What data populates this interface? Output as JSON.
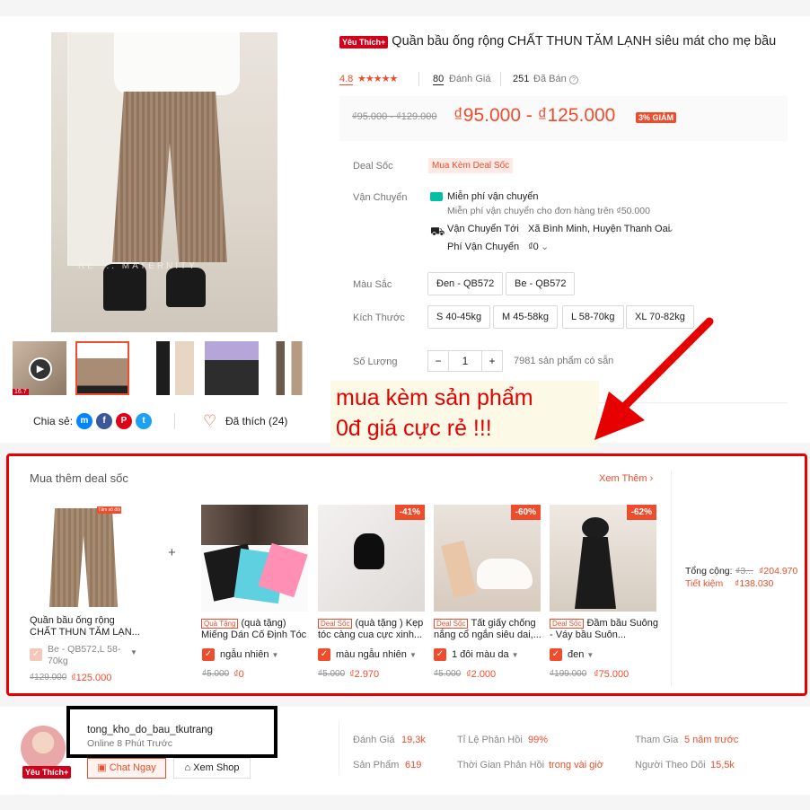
{
  "product": {
    "badge": "Yêu Thích+",
    "title": "Quần bầu ống rộng CHẤT THUN TĂM LẠNH siêu mát cho mẹ bầu",
    "rating": "4.8",
    "stars": "★★★★★",
    "reviews_count": "80",
    "reviews_label": "Đánh Giá",
    "sold_count": "251",
    "sold_label": "Đã Bán",
    "old_price": "₫95.000 - ₫129.000",
    "price": "₫95.000 - ₫125.000",
    "discount": "3% GIẢM",
    "image_watermark": "RE ... MATERNITY",
    "thumb_badge": "16.7"
  },
  "deal_row": {
    "label": "Deal Sốc",
    "tag": "Mua Kèm Deal Sốc"
  },
  "shipping": {
    "label": "Vận Chuyển",
    "free": "Miễn phí vận chuyển",
    "free_note": "Miễn phí vận chuyển cho đơn hàng trên ₫50.000",
    "to_label": "Vận Chuyển Tới",
    "to_value": "Xã Bình Minh, Huyện Thanh Oai",
    "fee_label": "Phí Vận Chuyển",
    "fee_value": "₫0"
  },
  "color": {
    "label": "Màu Sắc",
    "options": [
      "Đen - QB572",
      "Be - QB572"
    ]
  },
  "size": {
    "label": "Kích Thước",
    "options": [
      "S 40-45kg",
      "M 45-58kg",
      "L 58-70kg",
      "XL 70-82kg"
    ]
  },
  "quantity": {
    "label": "Số Lượng",
    "minus": "−",
    "value": "1",
    "plus": "+",
    "stock": "7981 sản phẩm có sẵn"
  },
  "share": {
    "label": "Chia sẻ:",
    "liked": "Đã thích (24)"
  },
  "annotation": {
    "line1": "mua kèm sản phẩm",
    "line2": "0đ giá cực rẻ !!!"
  },
  "deal_section": {
    "title": "Mua thêm deal sốc",
    "more": "Xem Thêm",
    "main_tag": "Tâm sô đôi",
    "plus": "+",
    "items": [
      {
        "tag": "",
        "name": "Quần bầu ống rộng CHẤT THUN TĂM LẠN...",
        "variant": "Be - QB572,L 58-70kg",
        "old": "₫129.000",
        "new": "₫125.000",
        "badge": ""
      },
      {
        "tag": "Quà Tặng",
        "name": "(quà tặng) Miếng Dán Cố Định Tóc",
        "variant": "ngẫu nhiên",
        "old": "₫5.000",
        "new": "₫0",
        "badge": ""
      },
      {
        "tag": "Deal Sốc",
        "name": "(quà tặng ) Kẹp tóc càng cua cực xinh...",
        "variant": "màu ngẫu nhiên",
        "old": "₫5.000",
        "new": "₫2.970",
        "badge": "-41%"
      },
      {
        "tag": "Deal Sốc",
        "name": "Tất giấy chống nắng cổ ngắn siêu dai,...",
        "variant": "1 đôi màu da",
        "old": "₫5.000",
        "new": "₫2.000",
        "badge": "-60%"
      },
      {
        "tag": "Deal Sốc",
        "name": "Đầm bầu Suông - Váy bầu Suôn...",
        "variant": "đen",
        "old": "₫199.000",
        "new": "₫75.000",
        "badge": "-62%"
      }
    ],
    "total_label": "Tổng cộng:",
    "total_old": "₫3...",
    "total_new": "₫204.970",
    "save_label": "Tiết kiệm",
    "save_value": "₫138.030"
  },
  "shop": {
    "badge": "Yêu Thích+",
    "name": "tong_kho_do_bau_tkutrang",
    "online": "Online 8 Phút Trước",
    "chat": "Chat Ngay",
    "view": "Xem Shop",
    "stats": [
      {
        "label": "Đánh Giá",
        "value": "19,3k"
      },
      {
        "label": "Sản Phẩm",
        "value": "619"
      },
      {
        "label": "Tỉ Lệ Phản Hồi",
        "value": "99%"
      },
      {
        "label": "Thời Gian Phản Hồi",
        "value": "trong vài giờ"
      },
      {
        "label": "Tham Gia",
        "value": "5 năm trước"
      },
      {
        "label": "Người Theo Dõi",
        "value": "15,5k"
      }
    ]
  },
  "colors": {
    "accent": "#ee4d2d",
    "annotation": "#e60000"
  }
}
